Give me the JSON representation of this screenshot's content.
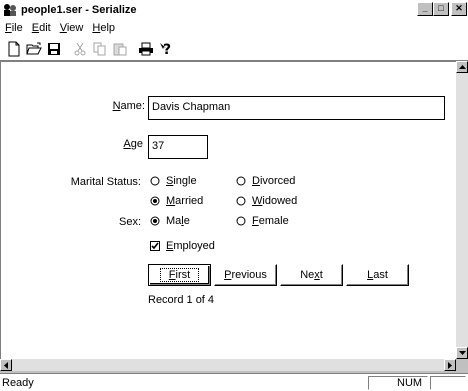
{
  "window": {
    "title": "people1.ser - Serialize",
    "minimize_glyph": "_",
    "maximize_glyph": "□",
    "close_glyph": "✕"
  },
  "menu": [
    {
      "label": "File",
      "mnemonic": "F",
      "rest": "ile"
    },
    {
      "label": "Edit",
      "mnemonic": "E",
      "rest": "dit"
    },
    {
      "label": "View",
      "mnemonic": "V",
      "rest": "iew"
    },
    {
      "label": "Help",
      "mnemonic": "H",
      "rest": "elp"
    }
  ],
  "toolbar": [
    "new-icon",
    "open-icon",
    "save-icon",
    "cut-icon",
    "copy-icon",
    "paste-icon",
    "print-icon",
    "help-icon"
  ],
  "form": {
    "name_label_u": "N",
    "name_label_rest": "ame:",
    "name_value": "Davis Chapman",
    "age_label_u": "A",
    "age_label_rest": "ge",
    "age_value": "37",
    "marital_label": "Marital Status:",
    "marital_options": [
      {
        "pre": "",
        "u": "S",
        "post": "ingle",
        "checked": false
      },
      {
        "pre": "",
        "u": "D",
        "post": "ivorced",
        "checked": false
      },
      {
        "pre": "",
        "u": "M",
        "post": "arried",
        "checked": true
      },
      {
        "pre": "",
        "u": "W",
        "post": "idowed",
        "checked": false
      }
    ],
    "sex_label": "Sex:",
    "sex_options": [
      {
        "pre": "Ma",
        "u": "l",
        "post": "e",
        "checked": true
      },
      {
        "pre": "",
        "u": "F",
        "post": "emale",
        "checked": false
      }
    ],
    "employed": {
      "u": "E",
      "rest": "mployed",
      "checked": true
    },
    "buttons": {
      "first": {
        "u": "F",
        "rest": "irst"
      },
      "previous": {
        "u": "P",
        "rest": "revious"
      },
      "next": {
        "pre": "Ne",
        "u": "x",
        "rest": "t"
      },
      "last": {
        "u": "L",
        "rest": "ast"
      }
    },
    "record_text": "Record 1 of 4"
  },
  "status": {
    "text": "Ready",
    "num": "NUM"
  }
}
